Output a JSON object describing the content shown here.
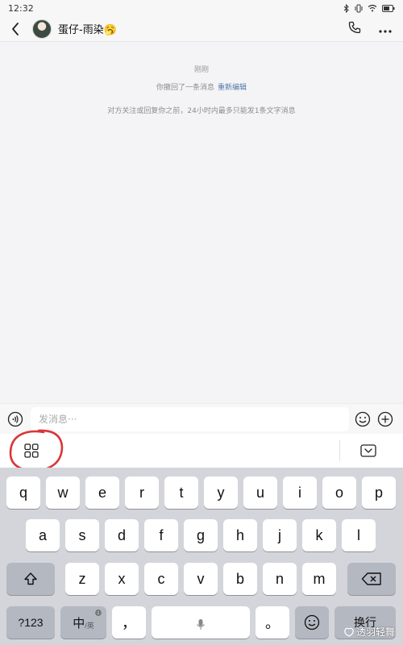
{
  "status_bar": {
    "time": "12:32"
  },
  "header": {
    "contact_name": "蛋仔-雨染🥱"
  },
  "messages": {
    "time": "刚刚",
    "recall_text": "你撤回了一条消息",
    "recall_link": "重新编辑",
    "notice": "对方关注或回复你之前，24小时内最多只能发1条文字消息"
  },
  "input_bar": {
    "placeholder": "发消息···"
  },
  "keyboard": {
    "row1": [
      "q",
      "w",
      "e",
      "r",
      "t",
      "y",
      "u",
      "i",
      "o",
      "p"
    ],
    "row2": [
      "a",
      "s",
      "d",
      "f",
      "g",
      "h",
      "j",
      "k",
      "l"
    ],
    "row3": [
      "z",
      "x",
      "c",
      "v",
      "b",
      "n",
      "m"
    ],
    "num_key": "?123",
    "lang_key_main": "中",
    "lang_key_sub": "/英",
    "comma_key": "，",
    "period_key": "。",
    "enter_key": "换行"
  },
  "watermark": "透羽轻舞"
}
